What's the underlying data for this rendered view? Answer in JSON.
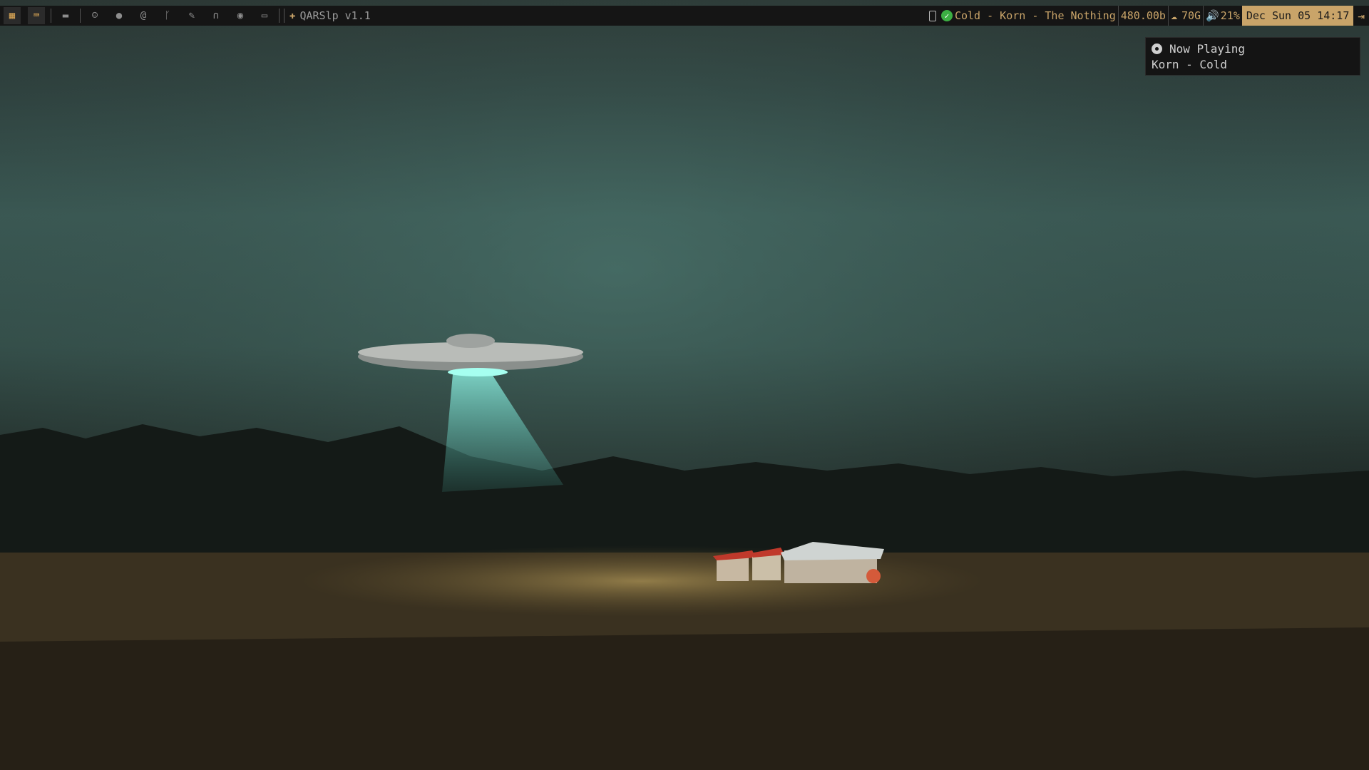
{
  "topbar": {
    "left_icons": [
      {
        "name": "workspace-grid-icon",
        "glyph": "▦",
        "active": true
      },
      {
        "name": "keyboard-icon",
        "glyph": "⌨",
        "active": true
      },
      {
        "name": "folder-icon",
        "glyph": "▬"
      },
      {
        "name": "finder-icon",
        "glyph": "☺"
      },
      {
        "name": "chat-icon",
        "glyph": "●"
      },
      {
        "name": "mail-at-icon",
        "glyph": "@"
      },
      {
        "name": "git-branch-icon",
        "glyph": "ᚴ"
      },
      {
        "name": "brush-icon",
        "glyph": "✎"
      },
      {
        "name": "headphones-icon",
        "glyph": "∩"
      },
      {
        "name": "steam-icon",
        "glyph": "◉"
      },
      {
        "name": "monitor-icon",
        "glyph": "▭"
      }
    ],
    "app_title": "QARSlp v1.1",
    "app_icon": "gear-icon",
    "now_playing": "Cold - Korn - The Nothing",
    "network": "480.00b",
    "weather_temp": "70G",
    "volume": "21%",
    "clock": "Dec Sun 05 14:17",
    "colors": {
      "accent": "#c9a469",
      "bar_bg": "#151515",
      "ok": "#3cb043"
    }
  },
  "notification": {
    "title": "Now Playing",
    "body": "Korn - Cold"
  }
}
